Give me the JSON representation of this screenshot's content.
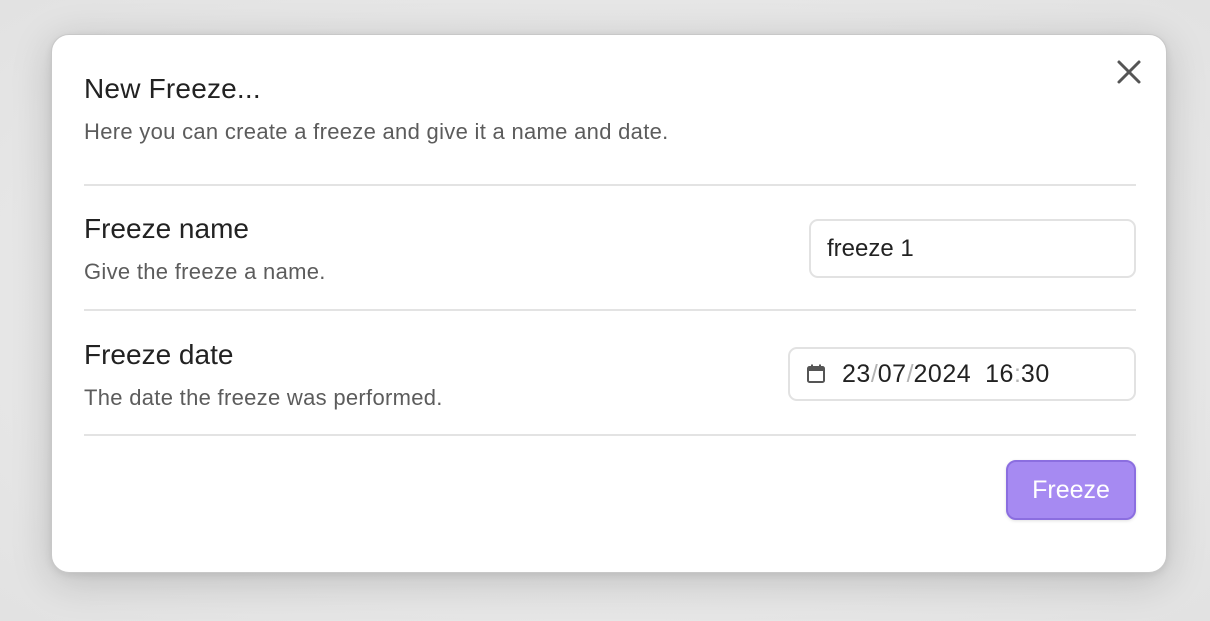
{
  "modal": {
    "title": "New Freeze...",
    "subtitle": "Here you can create a freeze and give it a name and date.",
    "close_icon": "close-icon"
  },
  "settings": {
    "name": {
      "label": "Freeze name",
      "description": "Give the freeze a name.",
      "value": "freeze 1"
    },
    "date": {
      "label": "Freeze date",
      "description": "The date the freeze was performed.",
      "day": "23",
      "month": "07",
      "year": "2024",
      "hour": "16",
      "minute": "30",
      "date_separator": "/",
      "time_separator": ":",
      "icon": "calendar-icon"
    }
  },
  "actions": {
    "submit_label": "Freeze"
  },
  "colors": {
    "accent": "#a68af2",
    "accent_border": "#8b6ee0",
    "text_primary": "#222222",
    "text_muted": "#5c5c5c"
  }
}
